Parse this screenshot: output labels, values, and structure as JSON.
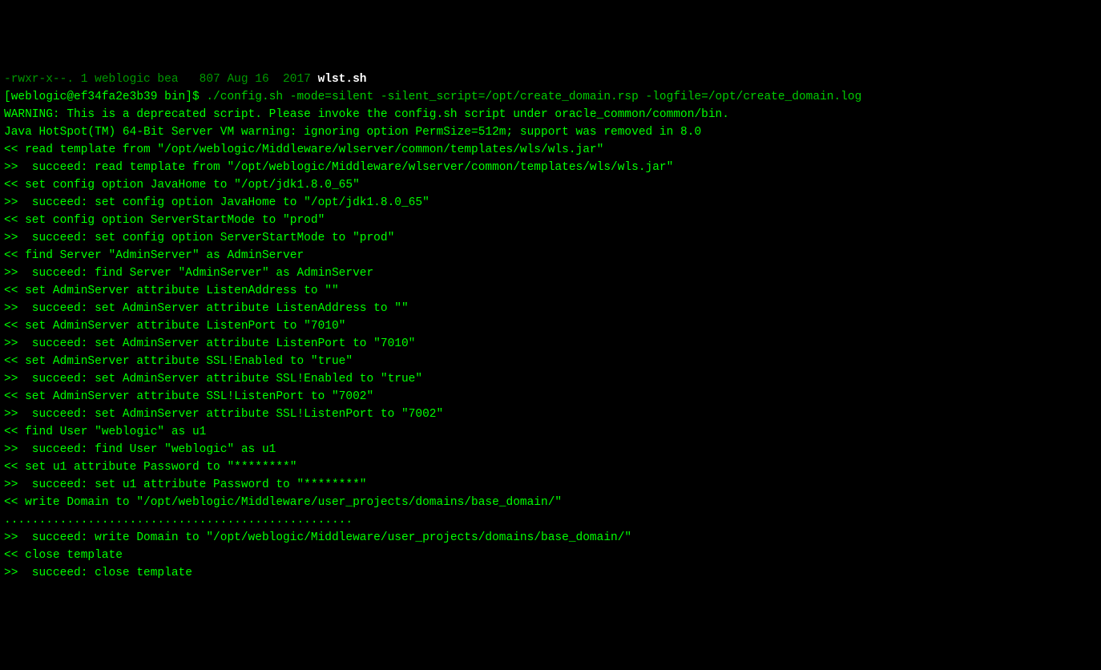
{
  "terminal": {
    "line0_partial": "-rwxr-x--. 1 weblogic bea   807 Aug 16  2017 ",
    "line0_filename": "wlst.sh",
    "prompt": "[weblogic@ef34fa2e3b39 bin]$ ",
    "command": "./config.sh -mode=silent -silent_script=/opt/create_domain.rsp -logfile=/opt/create_domain.log",
    "lines": [
      "WARNING: This is a deprecated script. Please invoke the config.sh script under oracle_common/common/bin.",
      "Java HotSpot(TM) 64-Bit Server VM warning: ignoring option PermSize=512m; support was removed in 8.0",
      "<< read template from \"/opt/weblogic/Middleware/wlserver/common/templates/wls/wls.jar\"",
      ">>  succeed: read template from \"/opt/weblogic/Middleware/wlserver/common/templates/wls/wls.jar\"",
      "<< set config option JavaHome to \"/opt/jdk1.8.0_65\"",
      ">>  succeed: set config option JavaHome to \"/opt/jdk1.8.0_65\"",
      "<< set config option ServerStartMode to \"prod\"",
      ">>  succeed: set config option ServerStartMode to \"prod\"",
      "<< find Server \"AdminServer\" as AdminServer",
      ">>  succeed: find Server \"AdminServer\" as AdminServer",
      "<< set AdminServer attribute ListenAddress to \"\"",
      ">>  succeed: set AdminServer attribute ListenAddress to \"\"",
      "<< set AdminServer attribute ListenPort to \"7010\"",
      ">>  succeed: set AdminServer attribute ListenPort to \"7010\"",
      "<< set AdminServer attribute SSL!Enabled to \"true\"",
      ">>  succeed: set AdminServer attribute SSL!Enabled to \"true\"",
      "<< set AdminServer attribute SSL!ListenPort to \"7002\"",
      ">>  succeed: set AdminServer attribute SSL!ListenPort to \"7002\"",
      "<< find User \"weblogic\" as u1",
      ">>  succeed: find User \"weblogic\" as u1",
      "<< set u1 attribute Password to \"********\"",
      ">>  succeed: set u1 attribute Password to \"********\"",
      "<< write Domain to \"/opt/weblogic/Middleware/user_projects/domains/base_domain/\"",
      "..................................................",
      ">>  succeed: write Domain to \"/opt/weblogic/Middleware/user_projects/domains/base_domain/\"",
      "<< close template",
      ">>  succeed: close template"
    ]
  }
}
